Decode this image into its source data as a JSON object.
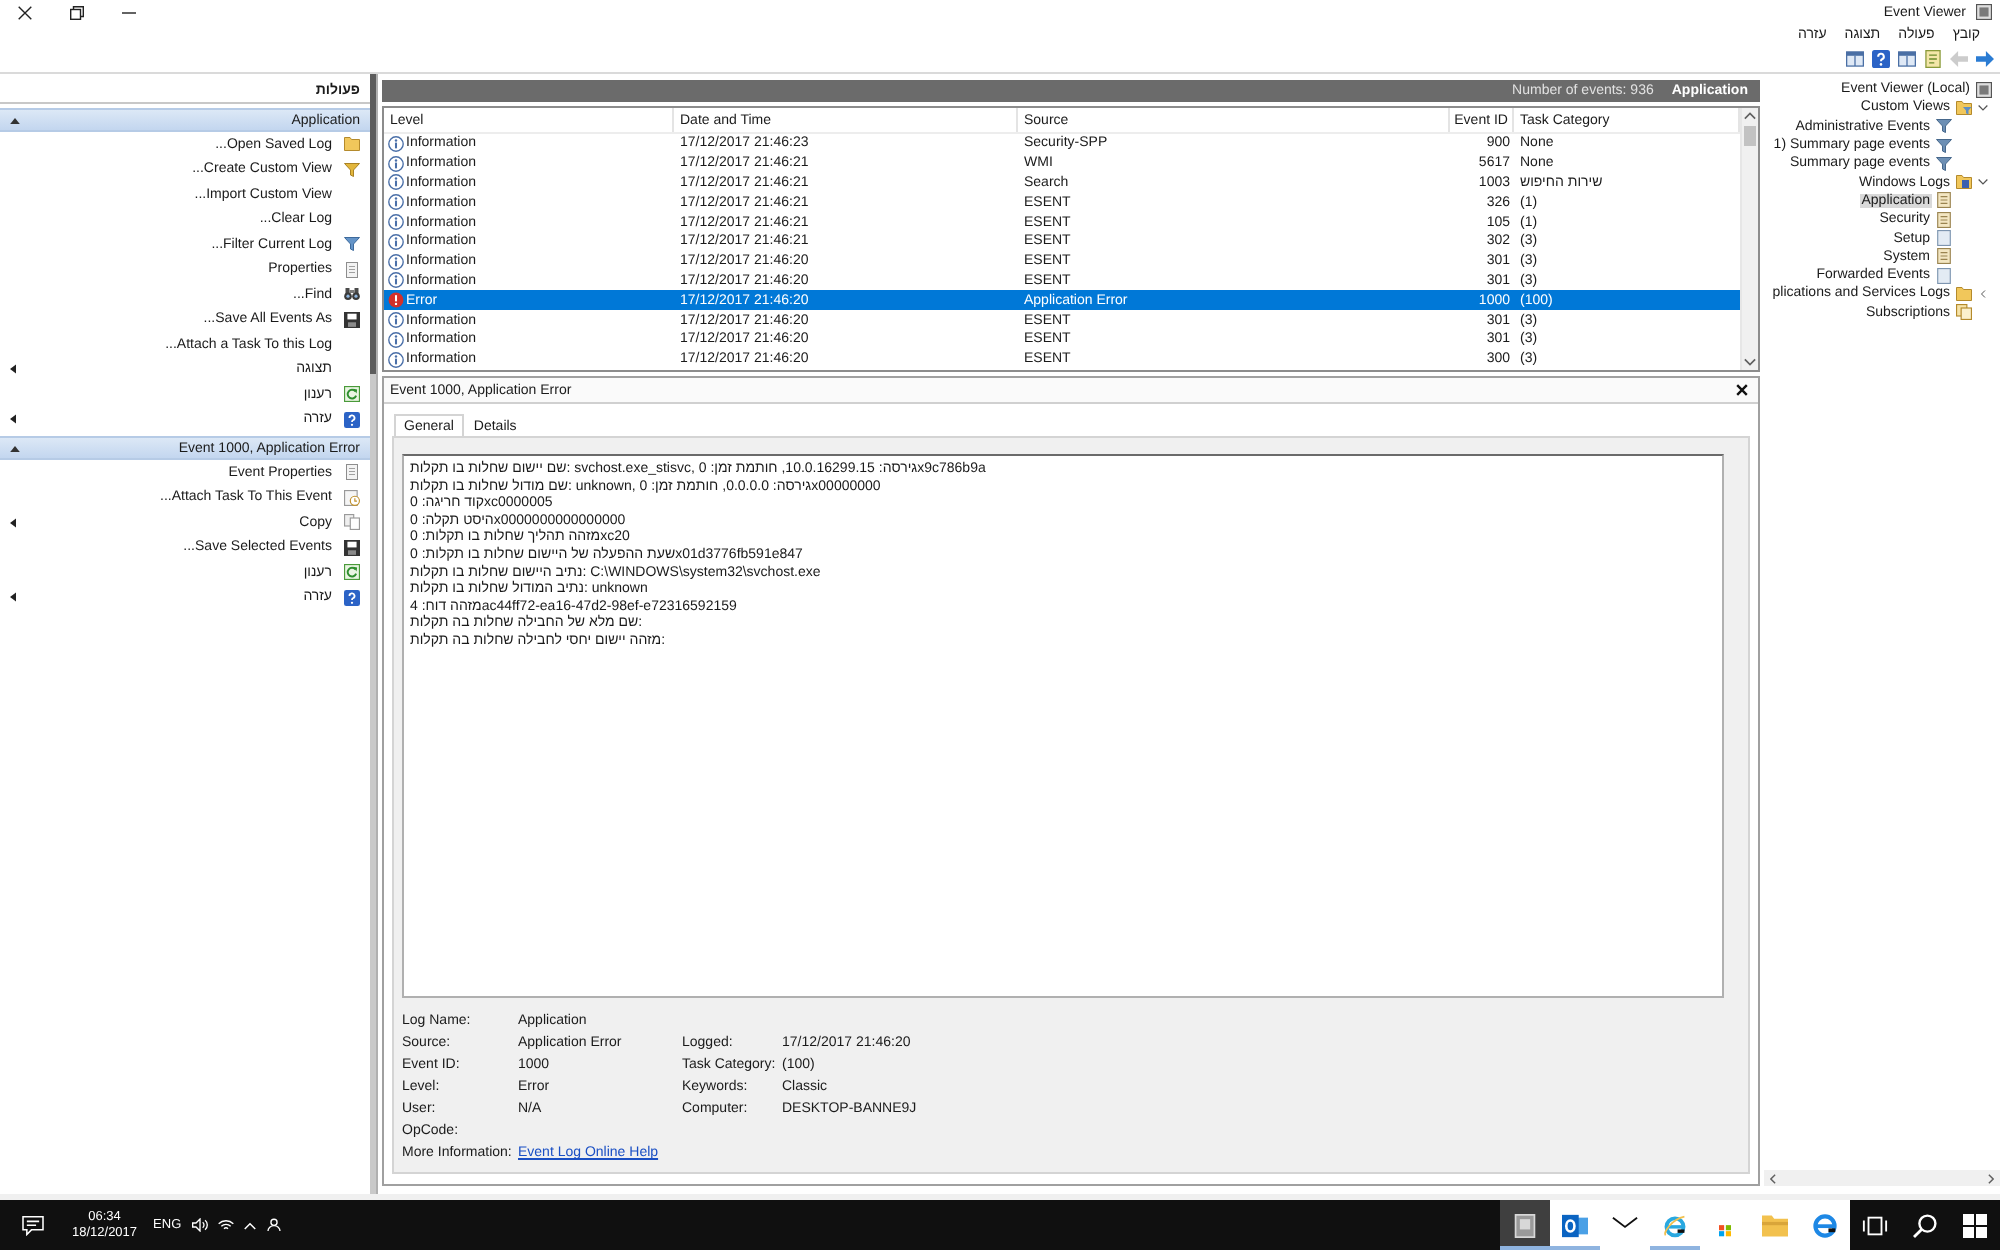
{
  "window": {
    "title": "Event Viewer",
    "menu": [
      "קובץ",
      "פעולה",
      "תצוגה",
      "עזרה"
    ]
  },
  "toolbar": [
    {
      "kind": "back",
      "disabled": false
    },
    {
      "kind": "forward",
      "disabled": true
    },
    {
      "kind": "page",
      "disabled": false
    },
    {
      "kind": "panes",
      "disabled": false
    },
    {
      "kind": "help",
      "disabled": false
    },
    {
      "kind": "panes",
      "disabled": false
    }
  ],
  "actions_pane": {
    "title": "פעולות",
    "sections": [
      {
        "title": "Application",
        "expanded": true,
        "items": [
          {
            "label": "...Open Saved Log",
            "kind": "folder",
            "submenu": false
          },
          {
            "label": "...Create Custom View",
            "kind": "new-filter",
            "submenu": false
          },
          {
            "label": "...Import Custom View",
            "kind": "none",
            "submenu": false
          },
          {
            "label": "...Clear Log",
            "kind": "none",
            "submenu": false
          },
          {
            "label": "...Filter Current Log",
            "kind": "filter",
            "submenu": false
          },
          {
            "label": "Properties",
            "kind": "properties",
            "submenu": false
          },
          {
            "label": "...Find",
            "kind": "find",
            "submenu": false
          },
          {
            "label": "...Save All Events As",
            "kind": "save",
            "submenu": false
          },
          {
            "label": "...Attach a Task To this Log",
            "kind": "none",
            "submenu": false
          },
          {
            "label": "תצוגה",
            "kind": "none",
            "submenu": true
          },
          {
            "label": "רענון",
            "kind": "refresh",
            "submenu": false
          },
          {
            "label": "עזרה",
            "kind": "help",
            "submenu": true
          }
        ]
      },
      {
        "title": "Event 1000, Application Error",
        "expanded": true,
        "items": [
          {
            "label": "Event Properties",
            "kind": "properties",
            "submenu": false
          },
          {
            "label": "...Attach Task To This Event",
            "kind": "task",
            "submenu": false
          },
          {
            "label": "Copy",
            "kind": "copy",
            "submenu": true
          },
          {
            "label": "...Save Selected Events",
            "kind": "save",
            "submenu": false
          },
          {
            "label": "רענון",
            "kind": "refresh",
            "submenu": false
          },
          {
            "label": "עזרה",
            "kind": "help",
            "submenu": true
          }
        ]
      }
    ]
  },
  "log_view": {
    "event_count": "Number of events: 936",
    "log_name": "Application",
    "columns": [
      "Level",
      "Date and Time",
      "Source",
      "Event ID",
      "Task Category"
    ],
    "rows": [
      {
        "kind": "information",
        "level": "Information",
        "date": "17/12/2017 21:46:23",
        "source": "Security-SPP",
        "event_id": "900",
        "task_category": "None",
        "selected": false
      },
      {
        "kind": "information",
        "level": "Information",
        "date": "17/12/2017 21:46:21",
        "source": "WMI",
        "event_id": "5617",
        "task_category": "None",
        "selected": false
      },
      {
        "kind": "information",
        "level": "Information",
        "date": "17/12/2017 21:46:21",
        "source": "Search",
        "event_id": "1003",
        "task_category": "שירות החיפוש",
        "selected": false
      },
      {
        "kind": "information",
        "level": "Information",
        "date": "17/12/2017 21:46:21",
        "source": "ESENT",
        "event_id": "326",
        "task_category": "(1)",
        "selected": false
      },
      {
        "kind": "information",
        "level": "Information",
        "date": "17/12/2017 21:46:21",
        "source": "ESENT",
        "event_id": "105",
        "task_category": "(1)",
        "selected": false
      },
      {
        "kind": "information",
        "level": "Information",
        "date": "17/12/2017 21:46:21",
        "source": "ESENT",
        "event_id": "302",
        "task_category": "(3)",
        "selected": false
      },
      {
        "kind": "information",
        "level": "Information",
        "date": "17/12/2017 21:46:20",
        "source": "ESENT",
        "event_id": "301",
        "task_category": "(3)",
        "selected": false
      },
      {
        "kind": "information",
        "level": "Information",
        "date": "17/12/2017 21:46:20",
        "source": "ESENT",
        "event_id": "301",
        "task_category": "(3)",
        "selected": false
      },
      {
        "kind": "error",
        "level": "Error",
        "date": "17/12/2017 21:46:20",
        "source": "Application Error",
        "event_id": "1000",
        "task_category": "(100)",
        "selected": true
      },
      {
        "kind": "information",
        "level": "Information",
        "date": "17/12/2017 21:46:20",
        "source": "ESENT",
        "event_id": "301",
        "task_category": "(3)",
        "selected": false
      },
      {
        "kind": "information",
        "level": "Information",
        "date": "17/12/2017 21:46:20",
        "source": "ESENT",
        "event_id": "301",
        "task_category": "(3)",
        "selected": false
      },
      {
        "kind": "information",
        "level": "Information",
        "date": "17/12/2017 21:46:20",
        "source": "ESENT",
        "event_id": "300",
        "task_category": "(3)",
        "selected": false
      }
    ]
  },
  "event_detail": {
    "title": "Event 1000, Application Error",
    "tabs": [
      {
        "label": "General",
        "selected": true
      },
      {
        "label": "Details",
        "selected": false
      }
    ],
    "description": [
      "שם יישום שחלות בו תקלות: svchost.exe_stisvc, גירסה: 10.0.16299.15, חותמת זמן: 0x9c786b9a",
      "שם מודול שחלות בו תקלות: unknown, גירסה: 0.0.0.0, חותמת זמן: 0x00000000",
      "קוד חריגה: 0xc0000005",
      "היסט תקלה: 0x0000000000000000",
      "מזהה תהליך שחלות בו תקלות: 0xc20",
      "שעת ההפעלה של היישום שחלות בו תקלות: 0x01d3776fb591e847",
      "נתיב היישום שחלות בו תקלות: C:\\WINDOWS\\system32\\svchost.exe",
      "נתיב המודול שחלות בו תקלות: unknown",
      "מזהה דוח: 4ac44ff72-ea16-47d2-98ef-e72316592159",
      "שם מלא של החבילה שחלות בה תקלות:",
      "מזהה יישום יחסי לחבילה שחלות בה תקלות:"
    ],
    "fields": [
      [
        {
          "label": "Log Name:",
          "value": "Application"
        }
      ],
      [
        {
          "label": "Source:",
          "value": "Application Error"
        },
        {
          "label": "Logged:",
          "value": "17/12/2017 21:46:20"
        }
      ],
      [
        {
          "label": "Event ID:",
          "value": "1000"
        },
        {
          "label": "Task Category:",
          "value": "(100)"
        }
      ],
      [
        {
          "label": "Level:",
          "value": "Error"
        },
        {
          "label": "Keywords:",
          "value": "Classic"
        }
      ],
      [
        {
          "label": "User:",
          "value": "N/A"
        },
        {
          "label": "Computer:",
          "value": "DESKTOP-BANNE9J"
        }
      ],
      [
        {
          "label": "OpCode:"
        }
      ],
      [
        {
          "label": "More Information:",
          "link": "Event Log Online Help"
        }
      ]
    ]
  },
  "navigation_tree": {
    "items": [
      {
        "label": "Event Viewer (Local)",
        "kind": "viewer",
        "selected": false,
        "children": [
          {
            "label": "Custom Views",
            "kind": "custom-views",
            "selected": false,
            "expanded": true,
            "children": [
              {
                "label": "Administrative Events",
                "kind": "filter",
                "selected": false
              },
              {
                "label": "1) Summary page events",
                "kind": "filter",
                "selected": false
              },
              {
                "label": "Summary page events",
                "kind": "filter",
                "selected": false
              }
            ]
          },
          {
            "label": "Windows Logs",
            "kind": "logs-folder",
            "selected": false,
            "expanded": true,
            "children": [
              {
                "label": "Application",
                "kind": "log",
                "selected": true
              },
              {
                "label": "Security",
                "kind": "log",
                "selected": false
              },
              {
                "label": "Setup",
                "kind": "plain-log",
                "selected": false
              },
              {
                "label": "System",
                "kind": "log",
                "selected": false
              },
              {
                "label": "Forwarded Events",
                "kind": "plain-log",
                "selected": false
              }
            ]
          },
          {
            "label": "plications and Services Logs",
            "kind": "folder",
            "selected": false,
            "expanded": false
          },
          {
            "label": "Subscriptions",
            "kind": "subscriptions",
            "selected": false
          }
        ]
      }
    ]
  },
  "taskbar": {
    "time": "06:34",
    "date": "18/12/2017",
    "language": "ENG",
    "apps": [
      {
        "kind": "edge",
        "active": false,
        "running": false
      },
      {
        "kind": "file-explorer",
        "active": false,
        "running": false
      },
      {
        "kind": "store",
        "active": false,
        "running": false
      },
      {
        "kind": "internet-explorer",
        "active": false,
        "running": true
      },
      {
        "kind": "mail",
        "active": false,
        "running": false
      },
      {
        "kind": "outlook",
        "active": false,
        "running": true
      },
      {
        "kind": "event-viewer",
        "active": true,
        "running": true
      }
    ]
  }
}
